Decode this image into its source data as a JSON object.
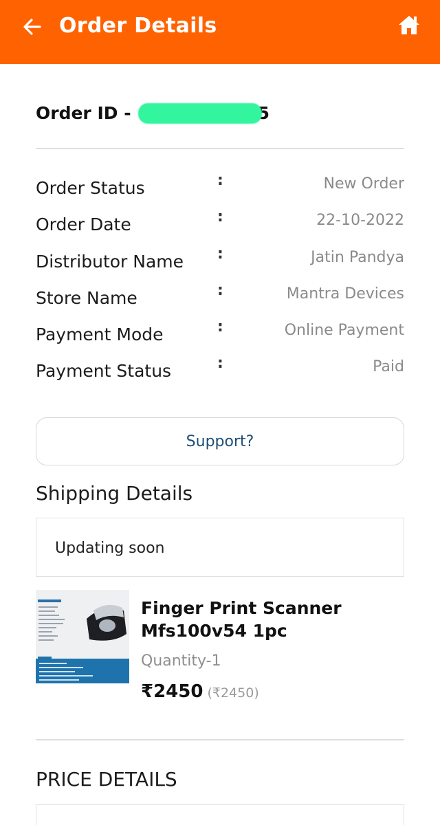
{
  "header": {
    "title": "Order Details",
    "background": "#ff6200",
    "back_icon": "arrow-left-icon",
    "home_icon": "home-icon"
  },
  "order": {
    "id_prefix": "Order ID -",
    "id_visible_suffix": "5"
  },
  "details": [
    {
      "label": "Order Status",
      "value": "New Order"
    },
    {
      "label": "Order Date",
      "value": "22-10-2022"
    },
    {
      "label": "Distributor Name",
      "value": "Jatin Pandya"
    },
    {
      "label": "Store Name",
      "value": "Mantra Devices"
    },
    {
      "label": "Payment Mode",
      "value": "Online Payment"
    },
    {
      "label": "Payment Status",
      "value": "Paid"
    }
  ],
  "colon": ":",
  "support": {
    "label": "Support?"
  },
  "shipping": {
    "title": "Shipping Details",
    "status": "Updating soon"
  },
  "product": {
    "name": "Finger Print Scanner Mfs100v54 1pc",
    "quantity": "Quantity-1",
    "price": "₹2450",
    "mrp": "(₹2450)"
  },
  "price_details": {
    "title": "PRICE DETAILS"
  }
}
